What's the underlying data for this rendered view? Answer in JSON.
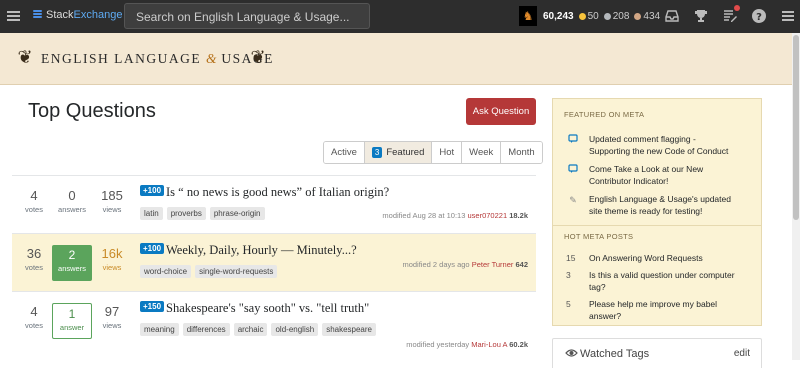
{
  "topbar": {
    "brand_prefix": "Stack",
    "brand_suffix": "Exchange",
    "search_placeholder": "Search on English Language & Usage...",
    "reputation": "60,243",
    "gold": "50",
    "silver": "208",
    "bronze": "434",
    "colors": {
      "gold": "#f7c33c",
      "silver": "#b4b8bc",
      "bronze": "#d1a684"
    }
  },
  "site": {
    "name_part1": "ENGLISH LANGUAGE",
    "amp": "&",
    "name_part2": "USAGE"
  },
  "main": {
    "title": "Top Questions",
    "ask_label": "Ask Question",
    "tabs": [
      {
        "label": "Active",
        "count": ""
      },
      {
        "label": "Featured",
        "count": "3"
      },
      {
        "label": "Hot",
        "count": ""
      },
      {
        "label": "Week",
        "count": ""
      },
      {
        "label": "Month",
        "count": ""
      }
    ],
    "questions": [
      {
        "votes": "4",
        "votes_label": "votes",
        "answers": "0",
        "answers_label": "answers",
        "views": "185",
        "views_label": "views",
        "bounty": "+100",
        "title": "Is “ no news is good news” of Italian origin?",
        "tags": [
          "latin",
          "proverbs",
          "phrase-origin"
        ],
        "modified": "modified Aug 28 at 10:13",
        "user": "user070221",
        "rep": "18.2k"
      },
      {
        "votes": "36",
        "votes_label": "votes",
        "answers": "2",
        "answers_label": "answers",
        "views": "16k",
        "views_label": "views",
        "bounty": "+100",
        "title": "Weekly, Daily, Hourly — Minutely...?",
        "tags": [
          "word-choice",
          "single-word-requests"
        ],
        "modified": "modified 2 days ago",
        "user": "Peter Turner",
        "rep": "642"
      },
      {
        "votes": "4",
        "votes_label": "votes",
        "answers": "1",
        "answers_label": "answer",
        "views": "97",
        "views_label": "views",
        "bounty": "+150",
        "title": "Shakespeare's \"say sooth\" vs. \"tell truth\"",
        "tags": [
          "meaning",
          "differences",
          "archaic",
          "old-english",
          "shakespeare"
        ],
        "modified": "modified yesterday",
        "user": "Mari-Lou A",
        "rep": "60.2k"
      }
    ]
  },
  "sidebar": {
    "featured_heading": "FEATURED ON META",
    "featured": [
      {
        "icon": "chat-icon",
        "lines": [
          "Updated comment flagging -",
          "Supporting the new Code of Conduct"
        ]
      },
      {
        "icon": "chat-icon",
        "lines": [
          "Come Take a Look at our New",
          "Contributor Indicator!"
        ]
      },
      {
        "icon": "pen-icon",
        "lines": [
          "English Language & Usage's updated",
          "site theme is ready for testing!"
        ]
      }
    ],
    "hot_heading": "HOT META POSTS",
    "hot": [
      {
        "count": "15",
        "lines": [
          "On Answering Word Requests"
        ]
      },
      {
        "count": "3",
        "lines": [
          "Is this a valid question under computer",
          "tag?"
        ]
      },
      {
        "count": "5",
        "lines": [
          "Please help me improve my babel",
          "answer?"
        ]
      }
    ],
    "watched_title": "Watched Tags",
    "watched_edit": "edit"
  }
}
